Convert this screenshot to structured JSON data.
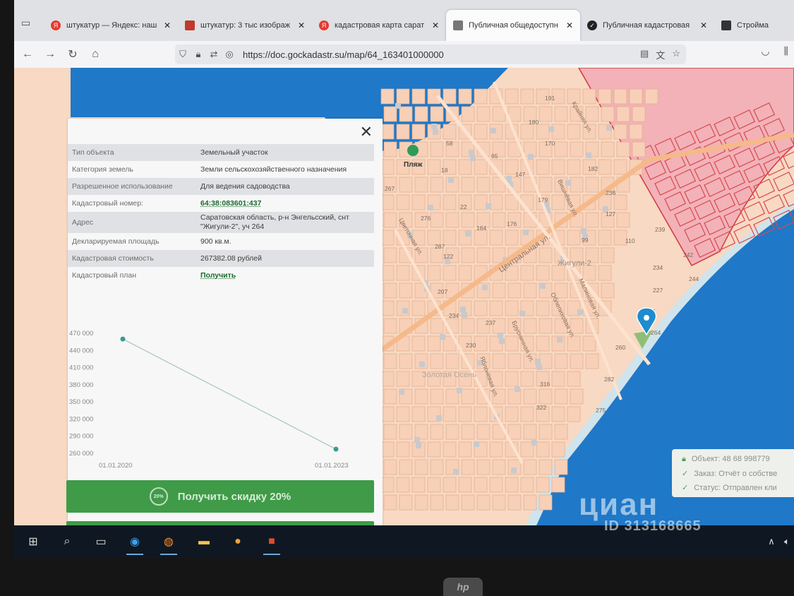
{
  "browser": {
    "tabs": [
      {
        "title": "штукатур — Яндекс: наш",
        "icon": "yandex-icon",
        "color": "#e8382c"
      },
      {
        "title": "штукатур: 3 тыс изображ",
        "icon": "images-icon",
        "color": "#c0392b"
      },
      {
        "title": "кадастровая карта сарат",
        "icon": "yandex-icon",
        "color": "#e8382c"
      },
      {
        "title": "Публичная общедоступн",
        "icon": "page-icon",
        "color": "#555555"
      },
      {
        "title": "Публичная кадастровая",
        "icon": "check-icon",
        "color": "#222222"
      },
      {
        "title": "Стройма",
        "icon": "site-icon",
        "color": "#333333"
      }
    ],
    "close_glyph": "✕",
    "url": "https://doc.gockadastr.su/map/64_163401000000"
  },
  "panel": {
    "rows": [
      {
        "key": "Тип объекта",
        "value": "Земельный участок"
      },
      {
        "key": "Категория земель",
        "value": "Земли сельскохозяйственного назначения"
      },
      {
        "key": "Разрешенное использование",
        "value": "Для ведения садоводства"
      },
      {
        "key": "Кадастровый номер:",
        "value": "64:38:083601:437"
      },
      {
        "key": "Адрес",
        "value": "Саратовская область, р-н Энгельсский, снт \"Жигули-2\", уч 264"
      },
      {
        "key": "Декларируемая площадь",
        "value": "900 кв.м."
      },
      {
        "key": "Кадастровая стоимость",
        "value": "267382.08 рублей"
      },
      {
        "key": "Кадастровый план",
        "value": "Получить"
      }
    ],
    "discount_button": "Получить скидку 20%",
    "discount_badge": "20%"
  },
  "chart_data": {
    "type": "line",
    "x": [
      "01.01.2020",
      "01.01.2023"
    ],
    "y_ticks": [
      "470 000",
      "440 000",
      "410 000",
      "380 000",
      "350 000",
      "320 000",
      "290 000",
      "260 000"
    ],
    "series": [
      {
        "values": [
          460000,
          267382
        ]
      }
    ],
    "ylim": [
      260000,
      470000
    ],
    "color": "#3c9a8f"
  },
  "map": {
    "labels": {
      "beach": "Пляж",
      "zhiguli": "Жигули-2",
      "zolotaya": "Золотая Осень",
      "central_st": "Центральная ул.",
      "kraynyaya": "Крайняя ул.",
      "vishnevaya": "Вишнёвая ул.",
      "malinovaya": "Малиновая ул.",
      "oblepikhovaya": "Облепиховая ул.",
      "brusnichnaya": "Брусничная ул.",
      "tsvetochnaya": "Цветочная ул.",
      "yablonevaya": "Яблоневая ул."
    },
    "plot_numbers": [
      "191",
      "180",
      "170",
      "182",
      "65",
      "147",
      "179",
      "238",
      "18",
      "22",
      "127",
      "176",
      "99",
      "110",
      "239",
      "242",
      "234",
      "227",
      "244",
      "231",
      "264",
      "260",
      "282",
      "316",
      "322",
      "275",
      "237",
      "234",
      "230",
      "207",
      "276",
      "287",
      "164",
      "267",
      "58",
      "122"
    ],
    "water_color": "#1f78c8",
    "land_color": "#f8d9c3",
    "restricted_color": "#f2b2b8"
  },
  "status_box": {
    "object": "Объект: 48 68 998779",
    "order": "Заказ: Отчёт о собстве",
    "status": "Статус: Отправлен кли"
  },
  "watermark": {
    "brand": "циан",
    "id": "ID 313168665"
  },
  "monitor_brand": "hp"
}
